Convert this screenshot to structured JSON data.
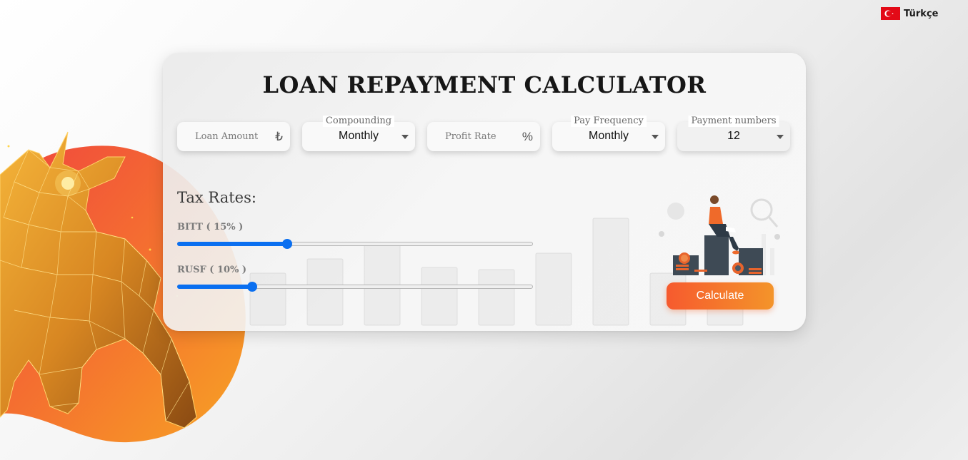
{
  "language": {
    "label": "Türkçe",
    "flag_icon": "turkey-flag-icon"
  },
  "title": "LOAN REPAYMENT CALCULATOR",
  "fields": {
    "loan_amount": {
      "placeholder": "Loan Amount",
      "suffix": "₺"
    },
    "compounding": {
      "label": "Compounding",
      "value": "Monthly"
    },
    "profit_rate": {
      "placeholder": "Profit Rate",
      "suffix": "%"
    },
    "pay_frequency": {
      "label": "Pay Frequency",
      "value": "Monthly"
    },
    "payment_numbers": {
      "label": "Payment numbers",
      "value": "12"
    }
  },
  "tax": {
    "title": "Tax Rates:",
    "bitt": {
      "label": "BITT ( 15% )",
      "value_percent": 15,
      "slider_fraction": 0.31
    },
    "rusf": {
      "label": "RUSF ( 10% )",
      "value_percent": 10,
      "slider_fraction": 0.21
    }
  },
  "calculate_label": "Calculate",
  "colors": {
    "accent_blue": "#0a6ff0",
    "button_start": "#f65a2e",
    "button_end": "#f4942a",
    "flag_red": "#e30a17",
    "art_orange": "#f58a2c"
  }
}
